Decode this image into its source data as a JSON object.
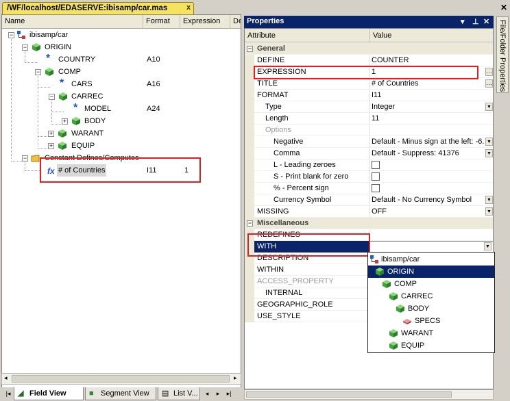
{
  "document_tab": {
    "title": "/WF/localhost/EDASERVE:ibisamp/car.mas",
    "close": "x"
  },
  "left_pane": {
    "columns": [
      "Name",
      "Format",
      "Expression",
      "De"
    ],
    "tree": {
      "root": "ibisamp/car",
      "origin": "ORIGIN",
      "country": {
        "label": "COUNTRY",
        "format": "A10"
      },
      "comp": "COMP",
      "cars": {
        "label": "CARS",
        "format": "A16"
      },
      "carrec": "CARREC",
      "model": {
        "label": "MODEL",
        "format": "A24"
      },
      "body": "BODY",
      "warant": "WARANT",
      "equip": "EQUIP",
      "defines": "Constant Defines/Computes",
      "countries": {
        "label": "# of Countries",
        "format": "I11",
        "expression": "1"
      }
    },
    "bottom_tabs": [
      "Field View",
      "Segment View",
      "List V..."
    ]
  },
  "properties": {
    "title": "Properties",
    "columns": {
      "attribute": "Attribute",
      "value": "Value"
    },
    "general_label": "General",
    "misc_label": "Miscellaneous",
    "rows": {
      "define": {
        "name": "DEFINE",
        "value": "COUNTER"
      },
      "expression": {
        "name": "EXPRESSION",
        "value": "1"
      },
      "title": {
        "name": "TITLE",
        "value": "# of Countries"
      },
      "format": {
        "name": "FORMAT",
        "value": "I11"
      },
      "type": {
        "name": "Type",
        "value": "Integer"
      },
      "length": {
        "name": "Length",
        "value": "11"
      },
      "options": {
        "name": "Options"
      },
      "negative": {
        "name": "Negative",
        "value": "Default - Minus sign at the left: -6."
      },
      "comma": {
        "name": "Comma",
        "value": "Default - Suppress: 41376"
      },
      "leading": {
        "name": "L - Leading zeroes"
      },
      "blank": {
        "name": "S - Print blank for zero"
      },
      "percent": {
        "name": "% - Percent sign"
      },
      "currency": {
        "name": "Currency Symbol",
        "value": "Default - No Currency Symbol"
      },
      "missing": {
        "name": "MISSING",
        "value": "OFF"
      },
      "redefines": {
        "name": "REDEFINES"
      },
      "with": {
        "name": "WITH"
      },
      "description": {
        "name": "DESCRIPTION"
      },
      "within": {
        "name": "WITHIN"
      },
      "access": {
        "name": "ACCESS_PROPERTY"
      },
      "internal": {
        "name": "INTERNAL"
      },
      "geo": {
        "name": "GEOGRAPHIC_ROLE"
      },
      "use_style": {
        "name": "USE_STYLE"
      }
    }
  },
  "with_popup": {
    "items": [
      "ibisamp/car",
      "ORIGIN",
      "COMP",
      "CARREC",
      "BODY",
      "SPECS",
      "WARANT",
      "EQUIP"
    ],
    "selected": "ORIGIN"
  },
  "side_tab": "File/Folder Properties",
  "colors": {
    "selection": "#0a246a",
    "highlight": "#e02020",
    "doc_tab": "#f5e35e"
  }
}
